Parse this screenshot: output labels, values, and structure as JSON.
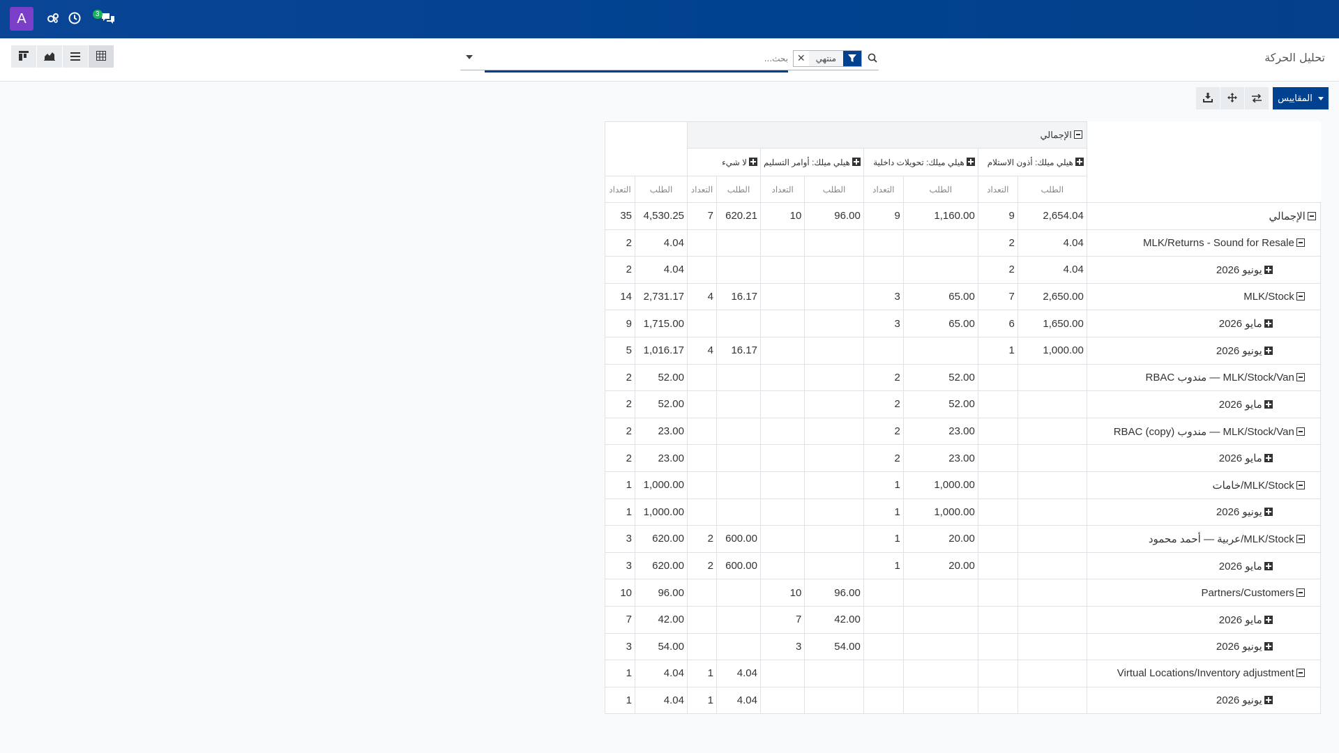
{
  "navbar": {
    "avatar_letter": "A",
    "messages_badge": "3",
    "colors": {
      "bar": "#00428f",
      "avatar": "#7a3ec9",
      "badge": "#1bb35a"
    },
    "icons": [
      "settings-gears-icon",
      "clock-icon",
      "chat-icon"
    ]
  },
  "control_panel": {
    "title": "تحليل الحركة",
    "search": {
      "placeholder": "بحث...",
      "facet_value": "منتهي"
    },
    "views": [
      "kanban-view",
      "graph-view",
      "list-view",
      "pivot-view"
    ]
  },
  "toolbar": {
    "measures_label": "المقاييس"
  },
  "pivot": {
    "total_label": "الإجمالي",
    "columns": [
      "هيلي ميلك: أذون الاستلام",
      "هيلي ميلك: تحويلات داخلية",
      "هيلي ميلك: أوامر التسليم",
      "لا شيء"
    ],
    "measures": [
      "الطلب",
      "التعداد"
    ],
    "rows": [
      {
        "label": "الإجمالي",
        "level": 0,
        "toggle": "minus",
        "cells": [
          "2,654.04",
          "9",
          "1,160.00",
          "9",
          "96.00",
          "10",
          "620.21",
          "7",
          "4,530.25",
          "35"
        ]
      },
      {
        "label": "MLK/Returns - Sound for Resale",
        "level": 1,
        "toggle": "minus",
        "cells": [
          "4.04",
          "2",
          "",
          "",
          "",
          "",
          "",
          "",
          "4.04",
          "2"
        ]
      },
      {
        "label": "يونيو 2026",
        "level": 2,
        "toggle": "plus",
        "cells": [
          "4.04",
          "2",
          "",
          "",
          "",
          "",
          "",
          "",
          "4.04",
          "2"
        ]
      },
      {
        "label": "MLK/Stock",
        "level": 1,
        "toggle": "minus",
        "cells": [
          "2,650.00",
          "7",
          "65.00",
          "3",
          "",
          "",
          "16.17",
          "4",
          "2,731.17",
          "14"
        ]
      },
      {
        "label": "مايو 2026",
        "level": 2,
        "toggle": "plus",
        "cells": [
          "1,650.00",
          "6",
          "65.00",
          "3",
          "",
          "",
          "",
          "",
          "1,715.00",
          "9"
        ]
      },
      {
        "label": "يونيو 2026",
        "level": 2,
        "toggle": "plus",
        "cells": [
          "1,000.00",
          "1",
          "",
          "",
          "",
          "",
          "16.17",
          "4",
          "1,016.17",
          "5"
        ]
      },
      {
        "label": "MLK/Stock/Van — مندوب RBAC",
        "level": 1,
        "toggle": "minus",
        "cells": [
          "",
          "",
          "52.00",
          "2",
          "",
          "",
          "",
          "",
          "52.00",
          "2"
        ]
      },
      {
        "label": "مايو 2026",
        "level": 2,
        "toggle": "plus",
        "cells": [
          "",
          "",
          "52.00",
          "2",
          "",
          "",
          "",
          "",
          "52.00",
          "2"
        ]
      },
      {
        "label": "MLK/Stock/Van — مندوب RBAC (copy)",
        "level": 1,
        "toggle": "minus",
        "cells": [
          "",
          "",
          "23.00",
          "2",
          "",
          "",
          "",
          "",
          "23.00",
          "2"
        ]
      },
      {
        "label": "مايو 2026",
        "level": 2,
        "toggle": "plus",
        "cells": [
          "",
          "",
          "23.00",
          "2",
          "",
          "",
          "",
          "",
          "23.00",
          "2"
        ]
      },
      {
        "label": "MLK/Stock/خامات",
        "level": 1,
        "toggle": "minus",
        "cells": [
          "",
          "",
          "1,000.00",
          "1",
          "",
          "",
          "",
          "",
          "1,000.00",
          "1"
        ]
      },
      {
        "label": "يونيو 2026",
        "level": 2,
        "toggle": "plus",
        "cells": [
          "",
          "",
          "1,000.00",
          "1",
          "",
          "",
          "",
          "",
          "1,000.00",
          "1"
        ]
      },
      {
        "label": "MLK/Stock/عربية — أحمد محمود",
        "level": 1,
        "toggle": "minus",
        "cells": [
          "",
          "",
          "20.00",
          "1",
          "",
          "",
          "600.00",
          "2",
          "620.00",
          "3"
        ]
      },
      {
        "label": "مايو 2026",
        "level": 2,
        "toggle": "plus",
        "cells": [
          "",
          "",
          "20.00",
          "1",
          "",
          "",
          "600.00",
          "2",
          "620.00",
          "3"
        ]
      },
      {
        "label": "Partners/Customers",
        "level": 1,
        "toggle": "minus",
        "cells": [
          "",
          "",
          "",
          "",
          "96.00",
          "10",
          "",
          "",
          "96.00",
          "10"
        ]
      },
      {
        "label": "مايو 2026",
        "level": 2,
        "toggle": "plus",
        "cells": [
          "",
          "",
          "",
          "",
          "42.00",
          "7",
          "",
          "",
          "42.00",
          "7"
        ]
      },
      {
        "label": "يونيو 2026",
        "level": 2,
        "toggle": "plus",
        "cells": [
          "",
          "",
          "",
          "",
          "54.00",
          "3",
          "",
          "",
          "54.00",
          "3"
        ]
      },
      {
        "label": "Virtual Locations/Inventory adjustment",
        "level": 1,
        "toggle": "minus",
        "cells": [
          "",
          "",
          "",
          "",
          "",
          "",
          "4.04",
          "1",
          "4.04",
          "1"
        ]
      },
      {
        "label": "يونيو 2026",
        "level": 2,
        "toggle": "plus",
        "cells": [
          "",
          "",
          "",
          "",
          "",
          "",
          "4.04",
          "1",
          "4.04",
          "1"
        ]
      }
    ]
  }
}
